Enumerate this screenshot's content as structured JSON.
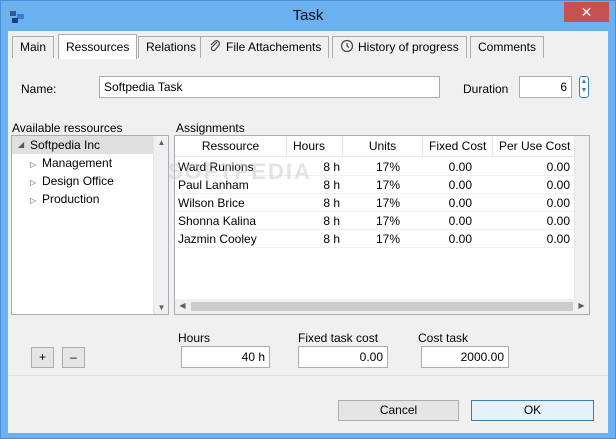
{
  "window": {
    "title": "Task",
    "close_glyph": "✕"
  },
  "tabs": [
    {
      "label": "Main",
      "icon": ""
    },
    {
      "label": "Ressources",
      "icon": ""
    },
    {
      "label": "Relations",
      "icon": ""
    },
    {
      "label": "File Attachements",
      "icon": "paperclip-icon"
    },
    {
      "label": "History of progress",
      "icon": "clock-icon"
    },
    {
      "label": "Comments",
      "icon": ""
    }
  ],
  "active_tab": "Ressources",
  "form": {
    "name_label": "Name:",
    "name_value": "Softpedia Task",
    "duration_label": "Duration",
    "duration_value": "6"
  },
  "resources": {
    "label": "Available ressources",
    "root": "Softpedia Inc",
    "children": [
      "Management",
      "Design Office",
      "Production"
    ]
  },
  "assignments": {
    "label": "Assignments",
    "columns": [
      "Ressource",
      "Hours",
      "Units",
      "Fixed Cost",
      "Per Use Cost"
    ],
    "rows": [
      [
        "Ward Runions",
        "8 h",
        "17%",
        "0.00",
        "0.00"
      ],
      [
        "Paul Lanham",
        "8 h",
        "17%",
        "0.00",
        "0.00"
      ],
      [
        "Wilson Brice",
        "8 h",
        "17%",
        "0.00",
        "0.00"
      ],
      [
        "Shonna Kalina",
        "8 h",
        "17%",
        "0.00",
        "0.00"
      ],
      [
        "Jazmin Cooley",
        "8 h",
        "17%",
        "0.00",
        "0.00"
      ]
    ]
  },
  "totals": {
    "hours_label": "Hours",
    "hours_value": "40 h",
    "fixed_cost_label": "Fixed task cost",
    "fixed_cost_value": "0.00",
    "cost_label": "Cost task",
    "cost_value": "2000.00"
  },
  "buttons": {
    "add": "+",
    "remove": "–",
    "cancel": "Cancel",
    "ok": "OK"
  },
  "watermark": "SOFTPEDIA"
}
